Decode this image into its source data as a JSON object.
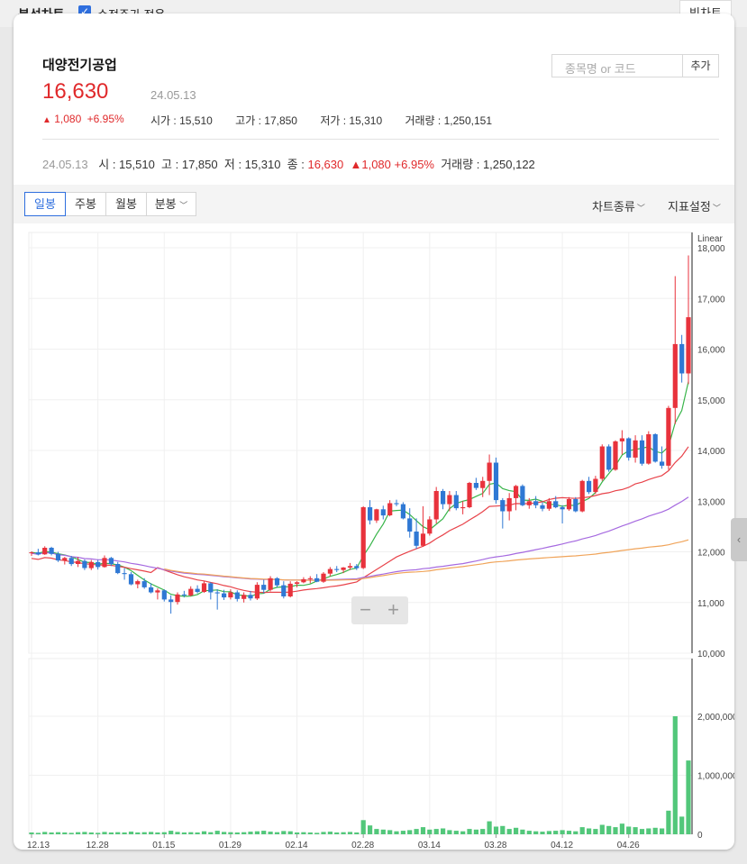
{
  "topbar": {
    "title": "분석차트",
    "checkbox_label": "수정주가 적용",
    "big_chart_button": "빅차트"
  },
  "stock": {
    "name": "대양전기공업",
    "price": "16,630",
    "date": "24.05.13",
    "change": "1,080",
    "change_pct": "+6.95%",
    "open_label": "시가",
    "open": "15,510",
    "high_label": "고가",
    "high": "17,850",
    "low_label": "저가",
    "low": "15,310",
    "volume_label": "거래량",
    "volume": "1,250,151"
  },
  "search": {
    "placeholder": "종목명 or 코드",
    "add_button": "추가"
  },
  "ohlc_line": {
    "date": "24.05.13",
    "open_label": "시",
    "open": "15,510",
    "high_label": "고",
    "high": "17,850",
    "low_label": "저",
    "low": "15,310",
    "close_label": "종",
    "close": "16,630",
    "change": "1,080",
    "change_pct": "+6.95%",
    "volume_label": "거래량",
    "volume": "1,250,122"
  },
  "toolbar": {
    "tabs": [
      "일봉",
      "주봉",
      "월봉",
      "분봉"
    ],
    "chart_type": "차트종류",
    "indicator_settings": "지표설정"
  },
  "colors": {
    "up": "#e8323c",
    "down": "#2f78d4",
    "volume": "#52c77a",
    "ma5": "#39b54a",
    "ma20": "#e8434a",
    "ma60": "#a66ae0",
    "ma120": "#f0a45a"
  },
  "chart_data": {
    "type": "candlestick",
    "scale_label": "Linear",
    "price_axis": {
      "min": 10000,
      "max": 18000,
      "ticks": [
        "18,000",
        "17,000",
        "16,000",
        "15,000",
        "14,000",
        "13,000",
        "12,000",
        "11,000",
        "10,000"
      ]
    },
    "volume_axis": {
      "ticks": [
        "2,000,000",
        "1,000,000",
        "0"
      ]
    },
    "x_tick_labels": [
      "12.13",
      "12.28",
      "01.15",
      "01.29",
      "02.14",
      "02.28",
      "03.14",
      "03.28",
      "04.12",
      "04.26"
    ],
    "x_tick_index": [
      0,
      10,
      20,
      30,
      40,
      50,
      60,
      70,
      80,
      90
    ],
    "moving_averages": [
      "ma5",
      "ma20",
      "ma60",
      "ma120"
    ],
    "candles": [
      [
        11980,
        12010,
        11920,
        11990,
        30000
      ],
      [
        11990,
        12060,
        11930,
        11950,
        25000
      ],
      [
        11950,
        12110,
        11940,
        12080,
        40000
      ],
      [
        12080,
        12100,
        11930,
        11960,
        30000
      ],
      [
        11960,
        12000,
        11800,
        11830,
        35000
      ],
      [
        11830,
        11900,
        11750,
        11880,
        30000
      ],
      [
        11880,
        11920,
        11720,
        11760,
        25000
      ],
      [
        11760,
        11900,
        11700,
        11820,
        35000
      ],
      [
        11820,
        11850,
        11640,
        11680,
        40000
      ],
      [
        11680,
        11840,
        11640,
        11800,
        30000
      ],
      [
        11800,
        11840,
        11650,
        11700,
        25000
      ],
      [
        11700,
        11930,
        11690,
        11880,
        40000
      ],
      [
        11880,
        11900,
        11720,
        11760,
        30000
      ],
      [
        11760,
        11800,
        11560,
        11580,
        35000
      ],
      [
        11580,
        11680,
        11450,
        11560,
        30000
      ],
      [
        11560,
        11600,
        11340,
        11360,
        45000
      ],
      [
        11360,
        11450,
        11280,
        11420,
        30000
      ],
      [
        11420,
        11480,
        11270,
        11300,
        35000
      ],
      [
        11300,
        11380,
        11180,
        11200,
        40000
      ],
      [
        11200,
        11280,
        11060,
        11240,
        30000
      ],
      [
        11240,
        11260,
        11020,
        11060,
        35000
      ],
      [
        11060,
        11140,
        10780,
        11010,
        60000
      ],
      [
        11010,
        11200,
        10960,
        11160,
        40000
      ],
      [
        11160,
        11230,
        11100,
        11140,
        30000
      ],
      [
        11140,
        11320,
        11120,
        11270,
        35000
      ],
      [
        11270,
        11340,
        11180,
        11210,
        30000
      ],
      [
        11210,
        11420,
        11190,
        11380,
        50000
      ],
      [
        11380,
        11400,
        11060,
        11200,
        35000
      ],
      [
        11200,
        11260,
        10860,
        11180,
        60000
      ],
      [
        11180,
        11250,
        11050,
        11100,
        40000
      ],
      [
        11100,
        11260,
        11060,
        11200,
        35000
      ],
      [
        11200,
        11240,
        11020,
        11070,
        30000
      ],
      [
        11070,
        11200,
        11000,
        11150,
        35000
      ],
      [
        11150,
        11230,
        11040,
        11080,
        45000
      ],
      [
        11080,
        11400,
        11050,
        11350,
        50000
      ],
      [
        11350,
        11450,
        11180,
        11250,
        60000
      ],
      [
        11250,
        11520,
        11220,
        11480,
        45000
      ],
      [
        11480,
        11500,
        11300,
        11340,
        35000
      ],
      [
        11340,
        11420,
        11080,
        11120,
        55000
      ],
      [
        11120,
        11420,
        11100,
        11370,
        50000
      ],
      [
        11370,
        11420,
        11300,
        11400,
        30000
      ],
      [
        11400,
        11500,
        11380,
        11460,
        35000
      ],
      [
        11460,
        11520,
        11380,
        11480,
        30000
      ],
      [
        11480,
        11560,
        11400,
        11410,
        25000
      ],
      [
        11410,
        11600,
        11390,
        11570,
        40000
      ],
      [
        11570,
        11700,
        11520,
        11660,
        45000
      ],
      [
        11660,
        11720,
        11600,
        11640,
        30000
      ],
      [
        11640,
        11700,
        11580,
        11690,
        35000
      ],
      [
        11690,
        11780,
        11640,
        11720,
        40000
      ],
      [
        11720,
        11760,
        11640,
        11680,
        30000
      ],
      [
        11680,
        12900,
        11660,
        12880,
        240000
      ],
      [
        12880,
        13020,
        12540,
        12620,
        150000
      ],
      [
        12620,
        12850,
        12570,
        12840,
        90000
      ],
      [
        12840,
        12910,
        12640,
        12720,
        80000
      ],
      [
        12720,
        13020,
        12700,
        12960,
        70000
      ],
      [
        12960,
        13030,
        12900,
        12940,
        50000
      ],
      [
        12940,
        12980,
        12640,
        12660,
        60000
      ],
      [
        12660,
        12860,
        12280,
        12400,
        70000
      ],
      [
        12400,
        12660,
        12060,
        12120,
        90000
      ],
      [
        12120,
        12900,
        12100,
        12360,
        120000
      ],
      [
        12360,
        12700,
        12320,
        12640,
        80000
      ],
      [
        12640,
        13280,
        12560,
        13200,
        90000
      ],
      [
        13200,
        13240,
        12840,
        12940,
        100000
      ],
      [
        12940,
        13200,
        12800,
        13120,
        70000
      ],
      [
        13120,
        13200,
        12820,
        12860,
        60000
      ],
      [
        12860,
        13000,
        12740,
        12880,
        50000
      ],
      [
        12880,
        13380,
        12860,
        13360,
        90000
      ],
      [
        13360,
        13460,
        13220,
        13260,
        80000
      ],
      [
        13260,
        13480,
        13080,
        13400,
        90000
      ],
      [
        13400,
        13920,
        13120,
        13760,
        220000
      ],
      [
        13760,
        13860,
        12950,
        13020,
        130000
      ],
      [
        13020,
        13060,
        12460,
        12800,
        140000
      ],
      [
        12800,
        13160,
        12620,
        13060,
        90000
      ],
      [
        13060,
        13320,
        12820,
        13300,
        110000
      ],
      [
        13300,
        13330,
        12900,
        12920,
        80000
      ],
      [
        12920,
        13060,
        12850,
        13000,
        60000
      ],
      [
        13000,
        13100,
        12860,
        12920,
        50000
      ],
      [
        12920,
        12980,
        12800,
        12850,
        45000
      ],
      [
        12850,
        13060,
        12810,
        13000,
        55000
      ],
      [
        13000,
        13100,
        12860,
        12880,
        60000
      ],
      [
        12880,
        12920,
        12560,
        12840,
        70000
      ],
      [
        12840,
        13080,
        12810,
        13040,
        60000
      ],
      [
        13040,
        13080,
        12780,
        12800,
        50000
      ],
      [
        12800,
        13420,
        12780,
        13400,
        120000
      ],
      [
        13400,
        13480,
        13140,
        13180,
        100000
      ],
      [
        13180,
        13500,
        13140,
        13440,
        90000
      ],
      [
        13440,
        14120,
        13400,
        14080,
        160000
      ],
      [
        14080,
        14120,
        13580,
        13620,
        140000
      ],
      [
        13620,
        14200,
        13600,
        14180,
        120000
      ],
      [
        14180,
        14400,
        13920,
        14240,
        180000
      ],
      [
        14240,
        14260,
        13800,
        13860,
        130000
      ],
      [
        13860,
        14300,
        13760,
        14200,
        120000
      ],
      [
        14200,
        14300,
        13700,
        13740,
        90000
      ],
      [
        13740,
        14380,
        13720,
        14320,
        100000
      ],
      [
        14320,
        14340,
        13760,
        13780,
        110000
      ],
      [
        13780,
        14080,
        13640,
        13700,
        100000
      ],
      [
        13700,
        14880,
        13620,
        14840,
        400000
      ],
      [
        14840,
        17440,
        14520,
        16100,
        2000000
      ],
      [
        16100,
        16280,
        15340,
        15520,
        300000
      ],
      [
        15520,
        17850,
        15310,
        16630,
        1250000
      ]
    ]
  }
}
